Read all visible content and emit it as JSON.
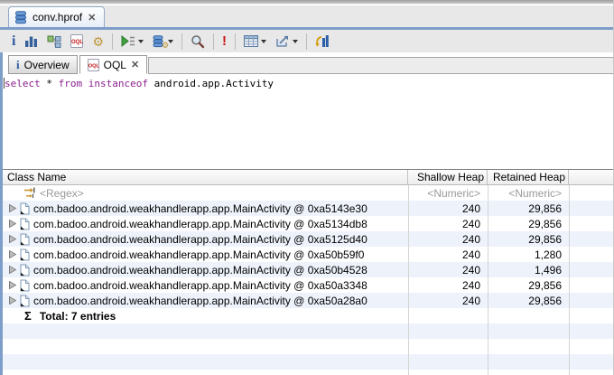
{
  "window": {
    "tab_title": "conv.hprof",
    "close_glyph": "✕"
  },
  "colors": {
    "keyline": "#7e9dc9",
    "row_stripe": "#edf2fb",
    "query_keyword": "#8b2190",
    "oql_icon_red": "#c41111",
    "toolbar_bg": "#e8e8e8"
  },
  "toolbar": {
    "icons": [
      "info-icon",
      "histogram-icon",
      "dominator-tree-icon",
      "oql-icon",
      "gear-icon",
      "run-report-icon",
      "heap-queries-icon",
      "search-icon",
      "error-icon",
      "calculator-icon",
      "export-icon",
      "refresh-histogram-icon"
    ]
  },
  "editor": {
    "tabs": [
      {
        "label": "Overview"
      },
      {
        "label": "OQL"
      }
    ],
    "query": {
      "t0": "select",
      "t1": " * ",
      "t2": "from",
      "t3": " ",
      "t4": "instanceof",
      "t5": " android.app.Activity"
    }
  },
  "table": {
    "columns": [
      "Class Name",
      "Shallow Heap",
      "Retained Heap"
    ],
    "filter": {
      "name": "<Regex>",
      "shallow": "<Numeric>",
      "retained": "<Numeric>"
    },
    "rows": [
      {
        "name": "com.badoo.android.weakhandlerapp.app.MainActivity @ 0xa5143e30",
        "shallow": "240",
        "retained": "29,856"
      },
      {
        "name": "com.badoo.android.weakhandlerapp.app.MainActivity @ 0xa5134db8",
        "shallow": "240",
        "retained": "29,856"
      },
      {
        "name": "com.badoo.android.weakhandlerapp.app.MainActivity @ 0xa5125d40",
        "shallow": "240",
        "retained": "29,856"
      },
      {
        "name": "com.badoo.android.weakhandlerapp.app.MainActivity @ 0xa50b59f0",
        "shallow": "240",
        "retained": "1,280"
      },
      {
        "name": "com.badoo.android.weakhandlerapp.app.MainActivity @ 0xa50b4528",
        "shallow": "240",
        "retained": "1,496"
      },
      {
        "name": "com.badoo.android.weakhandlerapp.app.MainActivity @ 0xa50a3348",
        "shallow": "240",
        "retained": "29,856"
      },
      {
        "name": "com.badoo.android.weakhandlerapp.app.MainActivity @ 0xa50a28a0",
        "shallow": "240",
        "retained": "29,856"
      }
    ],
    "total_sigma": "Σ",
    "total": "Total: 7 entries"
  }
}
